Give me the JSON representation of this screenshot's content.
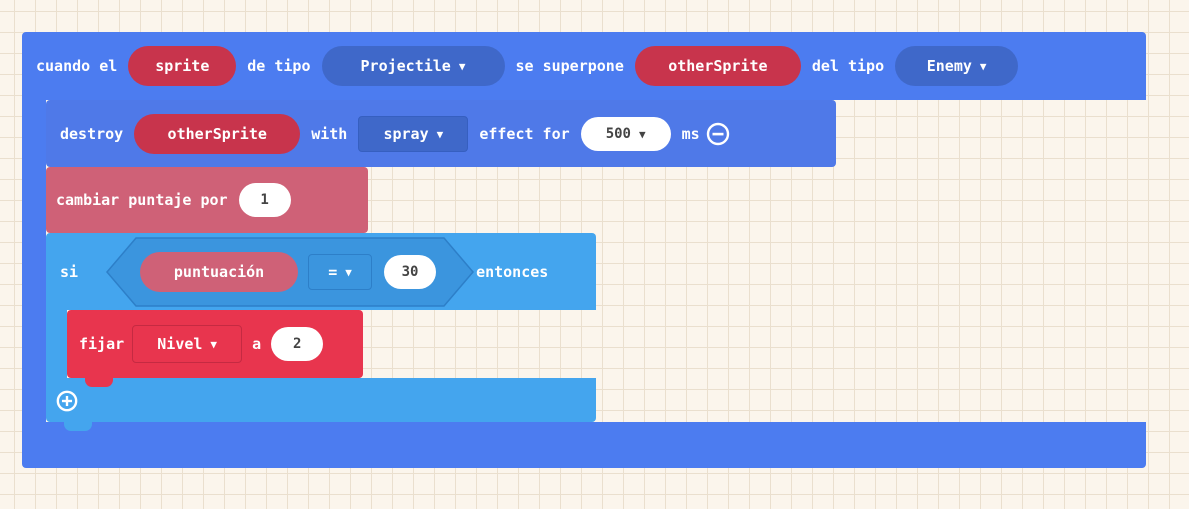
{
  "colors": {
    "event_block": "#4c7cf0",
    "sprites_block": "#4f79e8",
    "variable_pill": "#c8344c",
    "info_block": "#cf6177",
    "logic_block": "#44a5ee",
    "variables_block": "#e8354e",
    "grid_background": "#fbf5ec"
  },
  "event": {
    "when_label": "cuando el",
    "sprite_var": "sprite",
    "kind_label": "de tipo",
    "kind_value": "Projectile",
    "overlaps_label": "se superpone",
    "other_var": "otherSprite",
    "other_kind_label": "del tipo",
    "other_kind_value": "Enemy"
  },
  "destroy": {
    "verb": "destroy",
    "target": "otherSprite",
    "with_label": "with",
    "effect_value": "spray",
    "effect_label": "effect for",
    "duration": "500",
    "unit": "ms",
    "minus_icon": "remove-parameter-icon"
  },
  "score": {
    "label": "cambiar puntaje por",
    "value": "1"
  },
  "if_block": {
    "if_label": "si",
    "left": "puntuación",
    "operator": "=",
    "right": "30",
    "then_label": "entonces",
    "plus_icon": "add-branch-icon"
  },
  "set_block": {
    "label": "fijar",
    "variable": "Nivel",
    "to_label": "a",
    "value": "2"
  }
}
